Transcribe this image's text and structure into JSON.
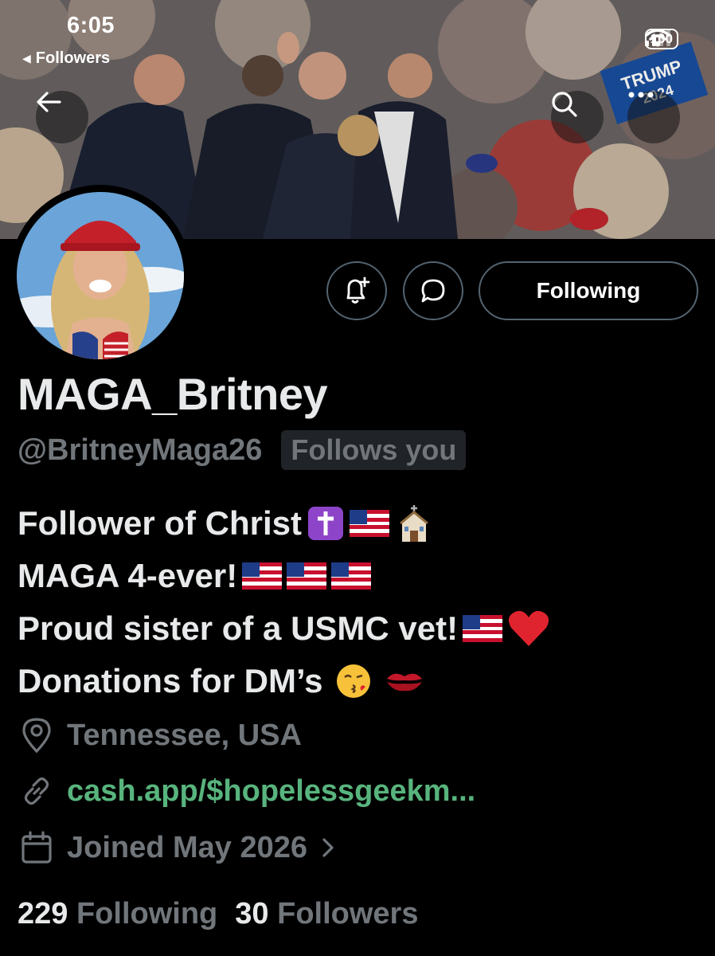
{
  "status_bar": {
    "time": "6:05",
    "back_label": "Followers",
    "battery": "100"
  },
  "profile": {
    "display_name": "MAGA_Britney",
    "handle": "@BritneyMaga26",
    "follows_you": "Follows you",
    "follow_button": "Following",
    "bio_lines": [
      "Follower of Christ",
      "MAGA 4-ever!",
      "Proud sister of a USMC vet!",
      "Donations for DM’s"
    ],
    "location": "Tennessee, USA",
    "website": "cash.app/$hopelessgeekm...",
    "joined": "Joined May 2026",
    "following_count": "229",
    "following_label": "Following",
    "followers_count": "30",
    "followers_label": "Followers"
  },
  "banner_text": {
    "sign_1": "TRUMP",
    "sign_2": "2024"
  },
  "icons": [
    "back-arrow-icon",
    "search-icon",
    "more-icon",
    "notification-bell-icon",
    "message-icon",
    "location-pin-icon",
    "link-icon",
    "calendar-icon",
    "chevron-right-icon",
    "wifi-icon",
    "signal-icon"
  ],
  "colors": {
    "background": "#000000",
    "text_primary": "#e7e9ea",
    "text_secondary": "#71767b",
    "link": "#58b47d",
    "border": "#536471"
  }
}
